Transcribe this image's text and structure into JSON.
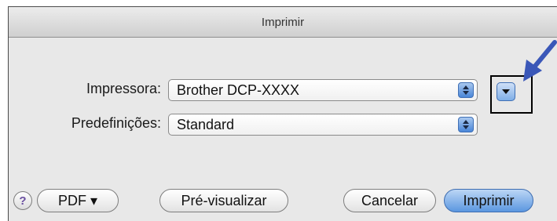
{
  "window": {
    "title": "Imprimir"
  },
  "form": {
    "printer_label": "Impressora:",
    "printer_value": "Brother DCP-XXXX",
    "presets_label": "Predefinições:",
    "presets_value": "Standard"
  },
  "buttons": {
    "help": "?",
    "pdf": "PDF ▾",
    "preview": "Pré-visualizar",
    "cancel": "Cancelar",
    "print": "Imprimir"
  },
  "icons": {
    "stepper": "up-down-stepper-icon",
    "disclosure": "disclosure-triangle-icon",
    "arrow": "pointer-arrow-icon"
  },
  "colors": {
    "accent": "#5b97e0",
    "arrow": "#3a57b8",
    "highlight": "#000000"
  }
}
